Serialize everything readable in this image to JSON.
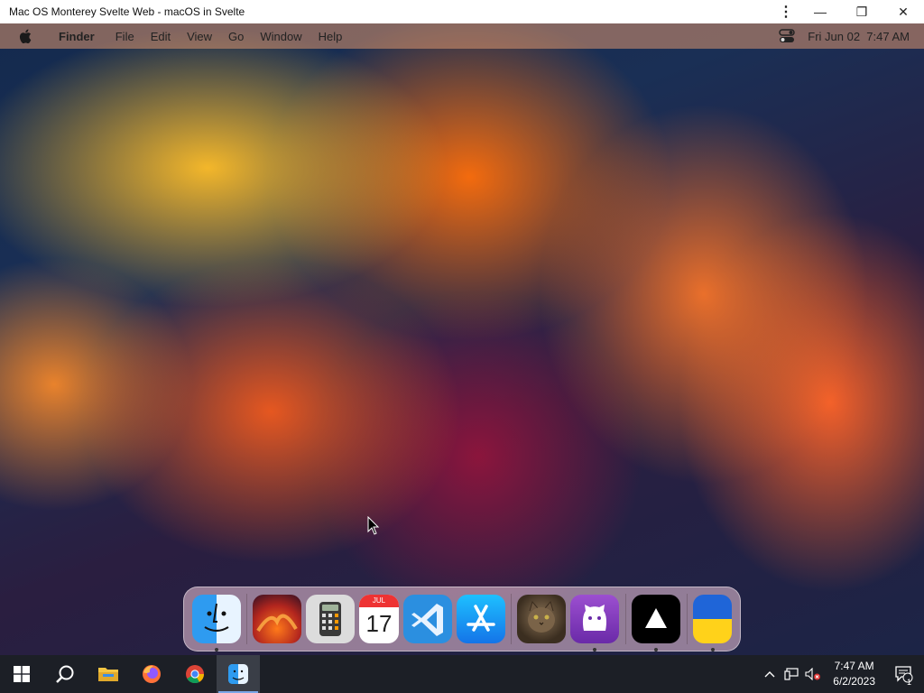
{
  "window": {
    "title": "Mac OS Monterey Svelte Web - macOS in Svelte",
    "controls": {
      "menu": "⋮",
      "minimize": "—",
      "restore": "❐",
      "close": "✕"
    }
  },
  "menubar": {
    "app_name": "Finder",
    "items": [
      "File",
      "Edit",
      "View",
      "Go",
      "Window",
      "Help"
    ],
    "date": "Fri Jun 02",
    "time": "7:47 AM"
  },
  "dock": {
    "apps": [
      {
        "name": "finder-app",
        "icon": "finder-icon",
        "running": true
      },
      {
        "name": "ventura-wallpapers-app",
        "icon": "ventura-icon",
        "running": false
      },
      {
        "name": "calculator-app",
        "icon": "calculator-icon",
        "running": false
      },
      {
        "name": "calendar-app",
        "icon": "calendar-icon",
        "running": false,
        "month": "JUL",
        "day": "17"
      },
      {
        "name": "vscode-app",
        "icon": "vscode-icon",
        "running": false
      },
      {
        "name": "app-store-app",
        "icon": "app-store-icon",
        "running": false
      },
      {
        "name": "cat-photo-app",
        "icon": "cat-icon",
        "running": false
      },
      {
        "name": "github-app",
        "icon": "github-icon",
        "running": true
      },
      {
        "name": "vercel-app",
        "icon": "vercel-icon",
        "running": true
      },
      {
        "name": "ukraine-app",
        "icon": "ukraine-flag-icon",
        "running": true
      }
    ]
  },
  "taskbar": {
    "clock_time": "7:47 AM",
    "clock_date": "6/2/2023",
    "notification_count": "1"
  },
  "colors": {
    "taskbar_bg": "#1c1f26",
    "accent": "#7aa7e8"
  }
}
